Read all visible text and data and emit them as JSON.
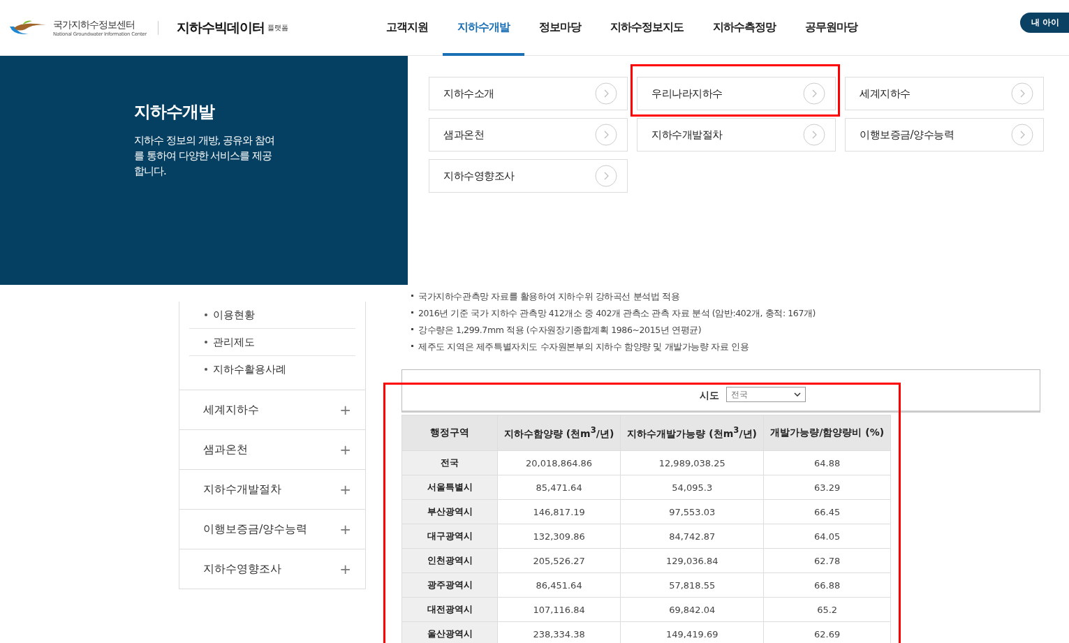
{
  "header": {
    "logo_text": "국가지하수정보센터",
    "logo_subtext": "National Groundwater Information Center",
    "platform_logo": "지하수빅데이터",
    "platform_suffix": "플랫폼",
    "nav": [
      {
        "label": "고객지원",
        "selected": false
      },
      {
        "label": "지하수개발",
        "selected": true
      },
      {
        "label": "정보마당",
        "selected": false
      },
      {
        "label": "지하수정보지도",
        "selected": false
      },
      {
        "label": "지하수측정망",
        "selected": false
      },
      {
        "label": "공무원마당",
        "selected": false
      }
    ],
    "user_button": "내 아이"
  },
  "mega_menu": {
    "title": "지하수개발",
    "description": "지하수 정보의 개방, 공유와 참여를 통하여 다양한 서비스를 제공합니다.",
    "links": [
      {
        "label": "지하수소개",
        "highlighted": false
      },
      {
        "label": "우리나라지하수",
        "highlighted": true
      },
      {
        "label": "세계지하수",
        "highlighted": false
      },
      {
        "label": "샘과온천",
        "highlighted": false
      },
      {
        "label": "지하수개발절차",
        "highlighted": false
      },
      {
        "label": "이행보증금/양수능력",
        "highlighted": false
      },
      {
        "label": "지하수영향조사",
        "highlighted": false
      }
    ]
  },
  "sidebar": {
    "sub_items": [
      "이용현황",
      "관리제도",
      "지하수활용사례"
    ],
    "sections": [
      "세계지하수",
      "샘과온천",
      "지하수개발절차",
      "이행보증금/양수능력",
      "지하수영향조사"
    ],
    "expand_symbol": "+"
  },
  "notes": [
    "국가지하수관측망 자료를 활용하여 지하수위 강하곡선 분석법 적용",
    "2016년 기준 국가 지하수 관측망 412개소 중 402개 관측소 관측 자료 분석 (암반:402개, 충적: 167개)",
    "강수량은 1,299.7mm 적용 (수자원장기종합계획 1986~2015년 연평균)",
    "제주도 지역은 제주특별자치도 수자원본부의 지하수 함양량 및 개발가능량 자료 인용"
  ],
  "filter": {
    "label": "시도",
    "value": "전국"
  },
  "table": {
    "highlighted": true,
    "columns": [
      "행정구역",
      "지하수함양량 (천m$^{3}$/년)",
      "지하수개발가능량 (천m$^{3}$/년)",
      "개발가능량/함양량비 (%)"
    ],
    "rows": [
      [
        "전국",
        "20,018,864.86",
        "12,989,038.25",
        "64.88"
      ],
      [
        "서울특별시",
        "85,471.64",
        "54,095.3",
        "63.29"
      ],
      [
        "부산광역시",
        "146,817.19",
        "97,553.03",
        "66.45"
      ],
      [
        "대구광역시",
        "132,309.86",
        "84,742.87",
        "64.05"
      ],
      [
        "인천광역시",
        "205,526.27",
        "129,036.84",
        "62.78"
      ],
      [
        "광주광역시",
        "86,451.64",
        "57,818.55",
        "66.88"
      ],
      [
        "대전광역시",
        "107,116.84",
        "69,842.04",
        "65.2"
      ],
      [
        "울산광역시",
        "238,334.38",
        "149,419.69",
        "62.69"
      ]
    ]
  }
}
